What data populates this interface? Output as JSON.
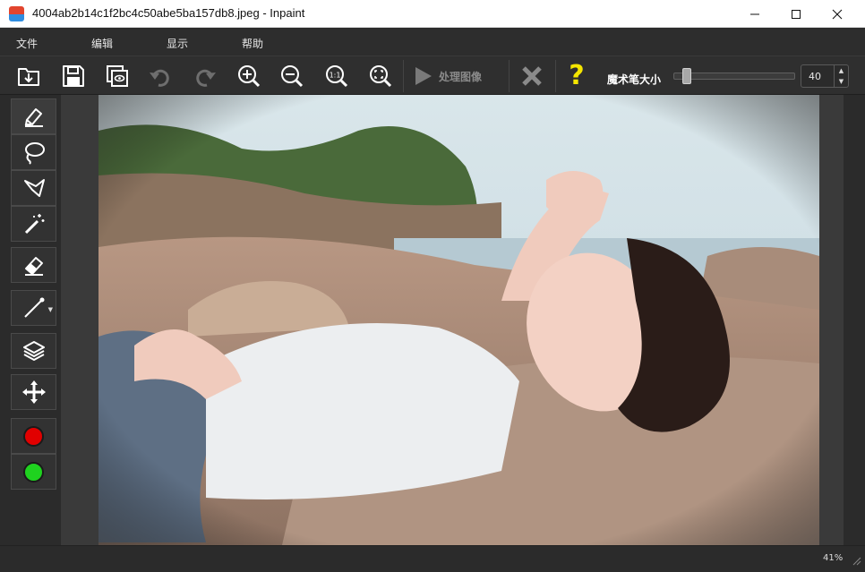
{
  "window": {
    "title": "4004ab2b14c1f2bc4c50abe5ba157db8.jpeg - Inpaint"
  },
  "menu": {
    "items": [
      "文件",
      "编辑",
      "显示",
      "帮助"
    ]
  },
  "toolbar": {
    "buttons": [
      "open-icon",
      "save-icon",
      "save-view-icon",
      "undo-icon",
      "redo-icon",
      "zoom-in-icon",
      "zoom-out-icon",
      "zoom-1to1-icon",
      "zoom-fit-icon"
    ],
    "process_label": "处理图像",
    "clear_icon": "x-icon",
    "help_label": "?",
    "brush_size_label": "魔术笔大小",
    "brush_size_value": "40",
    "brush_size_fraction": 0.05
  },
  "tools": [
    "marker",
    "lasso",
    "polygonal-lasso",
    "magic-wand",
    "eraser",
    "line-guide",
    "layers",
    "move"
  ],
  "colors": {
    "red": "#e10000",
    "green": "#1fd21f",
    "help": "#f5e600"
  },
  "status": {
    "zoom": "41%"
  }
}
